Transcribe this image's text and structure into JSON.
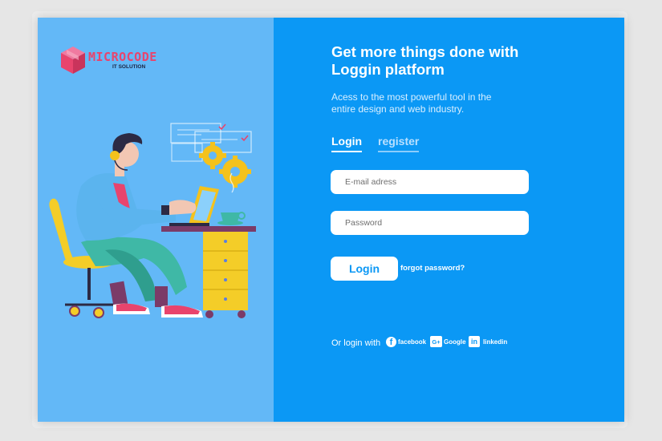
{
  "brand": {
    "name": "MICROCODE",
    "tagline": "IT SOLUTION",
    "logo_icon": "cube-logo-icon",
    "colors": {
      "logo": "#e8446d",
      "left_panel": "#63b8f7",
      "right_panel": "#0b98f5"
    }
  },
  "hero": {
    "illustration": "man-working-at-laptop-illustration"
  },
  "form": {
    "headline": "Get more things done with Loggin platform",
    "subtext": "Acess to the most powerful tool in the entire design and web industry.",
    "tabs": [
      {
        "label": "Login",
        "active": true
      },
      {
        "label": "register",
        "active": false
      }
    ],
    "email_placeholder": "E-mail adress",
    "password_placeholder": "Password",
    "login_button": "Login",
    "forgot_link": "forgot password?"
  },
  "social": {
    "label": "Or login with",
    "providers": [
      {
        "name": "facebook",
        "icon": "facebook-icon"
      },
      {
        "name": "Google",
        "icon": "google-plus-icon",
        "icon_text": "G+"
      },
      {
        "name": "linkedin",
        "icon": "linkedin-icon",
        "icon_text": "in"
      }
    ]
  }
}
